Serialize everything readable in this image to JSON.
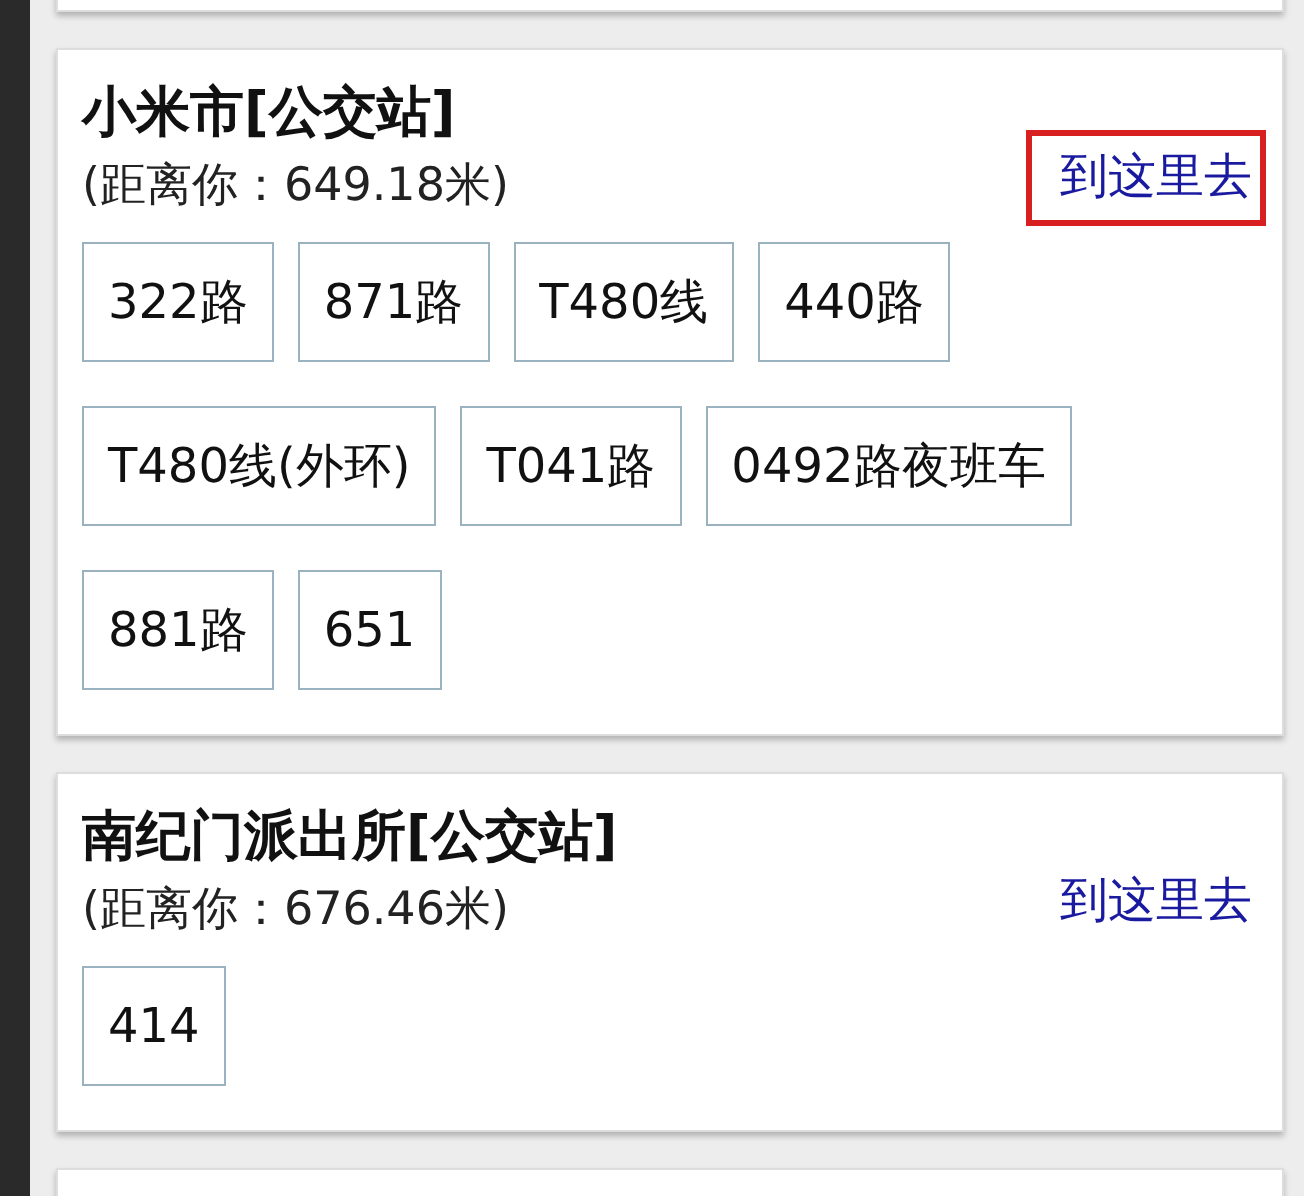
{
  "stations": [
    {
      "name": "小米市[公交站]",
      "distance": "(距离你：649.18米)",
      "link": {
        "label": "到这里去",
        "highlighted": true
      },
      "routes": [
        "322路",
        "871路",
        "T480线",
        "440路",
        "T480线(外环)",
        "T041路",
        "0492路夜班车",
        "881路",
        "651"
      ]
    },
    {
      "name": "南纪门派出所[公交站]",
      "distance": "(距离你：676.46米)",
      "link": {
        "label": "到这里去",
        "highlighted": false
      },
      "routes": [
        "414"
      ]
    }
  ]
}
